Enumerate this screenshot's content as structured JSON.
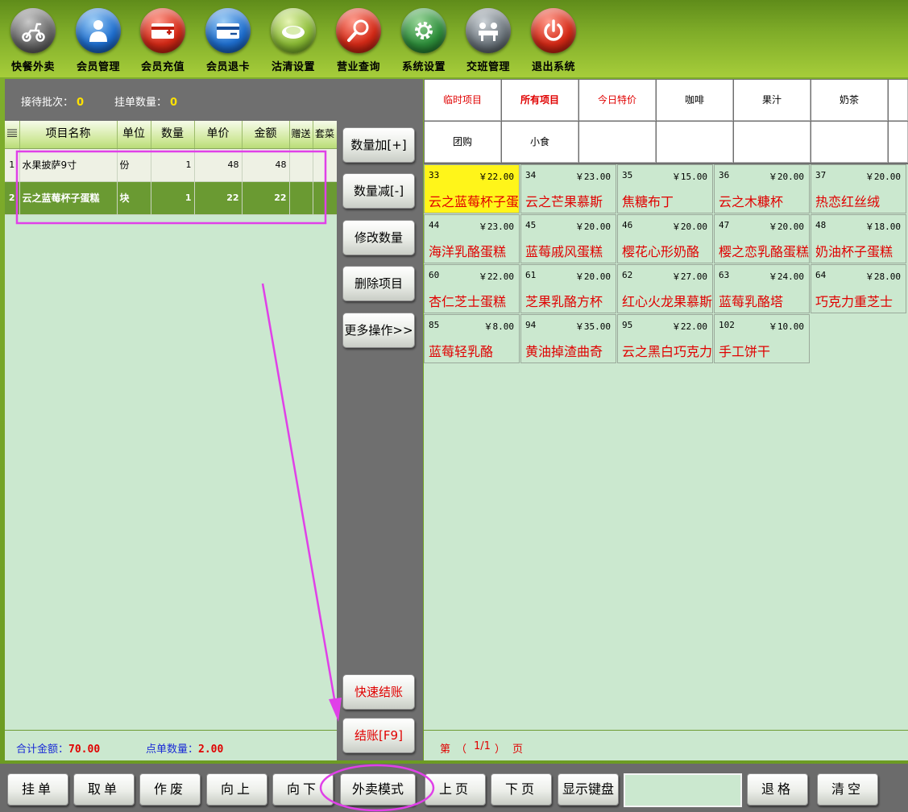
{
  "toolbar": {
    "items": [
      {
        "label": "快餐外卖",
        "icon": "scooter-icon"
      },
      {
        "label": "会员管理",
        "icon": "member-icon"
      },
      {
        "label": "会员充值",
        "icon": "card-recharge-icon"
      },
      {
        "label": "会员退卡",
        "icon": "card-refund-icon"
      },
      {
        "label": "沽清设置",
        "icon": "plate-icon"
      },
      {
        "label": "营业查询",
        "icon": "magnifier-icon"
      },
      {
        "label": "系统设置",
        "icon": "gear-icon"
      },
      {
        "label": "交班管理",
        "icon": "handover-icon"
      },
      {
        "label": "退出系统",
        "icon": "power-icon"
      }
    ]
  },
  "left": {
    "batch_label": "接待批次：",
    "batch_value": "0",
    "hang_label": "挂单数量：",
    "hang_value": "0",
    "table_headers": {
      "name": "项目名称",
      "unit": "单位",
      "qty": "数量",
      "price": "单价",
      "amount": "金额",
      "gift": "赠送",
      "combo": "套菜"
    },
    "rows": [
      {
        "idx": "1",
        "name": "水果披萨9寸",
        "unit": "份",
        "qty": "1",
        "price": "48",
        "amount": "48",
        "selected": false
      },
      {
        "idx": "2",
        "name": "云之蓝莓杯子蛋糕",
        "unit": "块",
        "qty": "1",
        "price": "22",
        "amount": "22",
        "selected": true
      }
    ],
    "total_label": "合计金额：",
    "total_value": "70.00",
    "count_label": "点单数量：",
    "count_value": "2.00"
  },
  "actions": {
    "qty_plus": "数量加[+]",
    "qty_minus": "数量减[-]",
    "edit_qty": "修改数量",
    "delete_item": "删除项目",
    "more": "更多操作>>",
    "quick_checkout": "快速结账",
    "checkout": "结账[F9]"
  },
  "categories": {
    "row1": [
      "临时项目",
      "所有项目",
      "今日特价",
      "咖啡",
      "果汁",
      "奶茶"
    ],
    "row2": [
      "团购",
      "小食"
    ]
  },
  "products": [
    {
      "id": "33",
      "price": "￥22.00",
      "name": "云之蓝莓杯子蛋糕",
      "highlight": true
    },
    {
      "id": "34",
      "price": "￥23.00",
      "name": "云之芒果慕斯"
    },
    {
      "id": "35",
      "price": "￥15.00",
      "name": "焦糖布丁"
    },
    {
      "id": "36",
      "price": "￥20.00",
      "name": "云之木糠杯"
    },
    {
      "id": "37",
      "price": "￥20.00",
      "name": "热恋红丝绒"
    },
    {
      "id": "44",
      "price": "￥23.00",
      "name": "海洋乳酪蛋糕"
    },
    {
      "id": "45",
      "price": "￥20.00",
      "name": "蓝莓戚风蛋糕"
    },
    {
      "id": "46",
      "price": "￥20.00",
      "name": "樱花心形奶酪"
    },
    {
      "id": "47",
      "price": "￥20.00",
      "name": "樱之恋乳酪蛋糕"
    },
    {
      "id": "48",
      "price": "￥18.00",
      "name": "奶油杯子蛋糕"
    },
    {
      "id": "60",
      "price": "￥22.00",
      "name": "杏仁芝士蛋糕"
    },
    {
      "id": "61",
      "price": "￥20.00",
      "name": "芝果乳酪方杯"
    },
    {
      "id": "62",
      "price": "￥27.00",
      "name": "红心火龙果慕斯"
    },
    {
      "id": "63",
      "price": "￥24.00",
      "name": "蓝莓乳酪塔"
    },
    {
      "id": "64",
      "price": "￥28.00",
      "name": "巧克力重芝士"
    },
    {
      "id": "85",
      "price": "￥8.00",
      "name": "蓝莓轻乳酪"
    },
    {
      "id": "94",
      "price": "￥35.00",
      "name": "黄油掉渣曲奇"
    },
    {
      "id": "95",
      "price": "￥22.00",
      "name": "云之黑白巧克力"
    },
    {
      "id": "102",
      "price": "￥10.00",
      "name": "手工饼干"
    }
  ],
  "paging": {
    "prefix": "第",
    "open": "（",
    "current": "1/1",
    "close": "）",
    "suffix": "页"
  },
  "bottom": {
    "hang": "挂单",
    "take": "取单",
    "void": "作废",
    "up": "向上",
    "down": "向下",
    "takeout_mode": "外卖模式",
    "prev_page": "上页",
    "next_page": "下页",
    "show_keyboard": "显示键盘",
    "input_value": "",
    "backspace": "退格",
    "clear": "清空"
  },
  "colors": {
    "accent_red": "#e00000",
    "highlight_yellow": "#fff51a",
    "selected_row": "#6a9a32",
    "annotation_magenta": "#e040e8"
  }
}
